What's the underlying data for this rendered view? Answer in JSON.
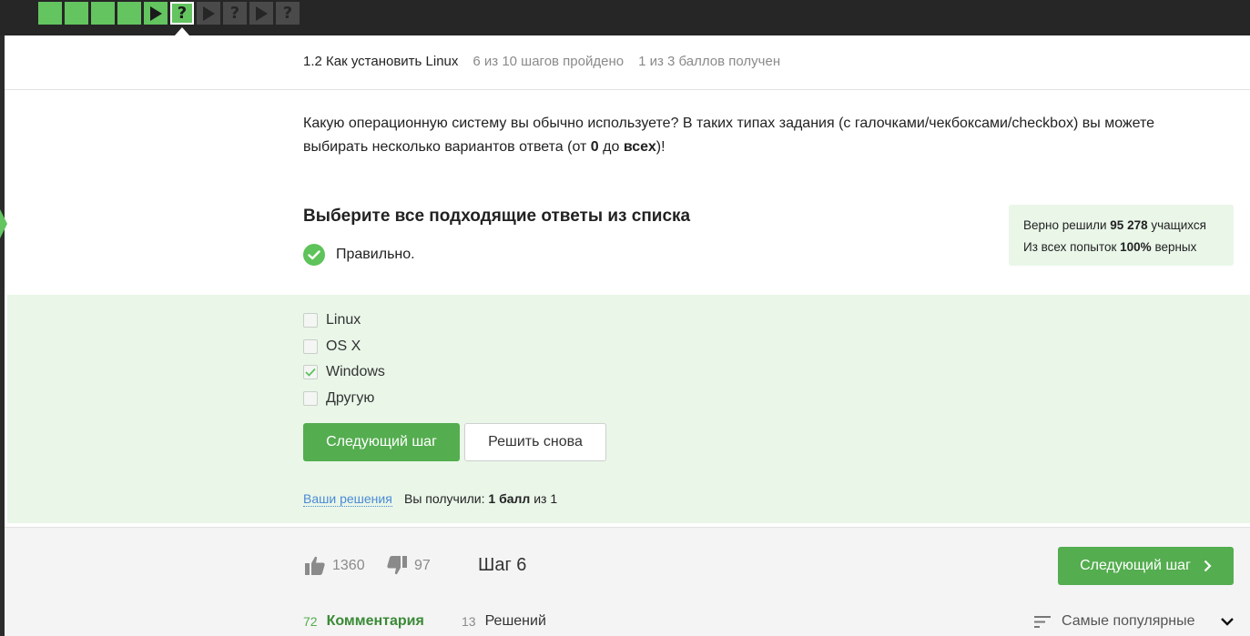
{
  "stepper": {
    "steps": [
      {
        "type": "done"
      },
      {
        "type": "done"
      },
      {
        "type": "done"
      },
      {
        "type": "done"
      },
      {
        "type": "play-done"
      },
      {
        "type": "current",
        "glyph": "?"
      },
      {
        "type": "play"
      },
      {
        "type": "question",
        "glyph": "?"
      },
      {
        "type": "play"
      },
      {
        "type": "question",
        "glyph": "?"
      }
    ]
  },
  "header": {
    "lesson": "1.2 Как установить Linux",
    "progress": "6 из 10 шагов пройдено",
    "points": "1 из 3 баллов  получен"
  },
  "question": {
    "text_before": "Какую операционную систему вы обычно используете? В таких типах задания (с галочками/чекбоксами/checkbox) вы можете выбирать несколько вариантов ответа (от ",
    "bold_from": "0",
    "text_mid": " до ",
    "bold_to": "всех",
    "text_after": ")!"
  },
  "task": {
    "title": "Выберите все подходящие ответы из списка",
    "verdict": "Правильно."
  },
  "stats": {
    "solved_prefix": "Верно решили ",
    "solved_count": "95 278",
    "solved_suffix": " учащихся",
    "attempts_prefix": "Из всех попыток ",
    "attempts_pct": "100%",
    "attempts_suffix": " верных"
  },
  "options": [
    {
      "label": "Linux",
      "checked": false
    },
    {
      "label": "OS X",
      "checked": false
    },
    {
      "label": "Windows",
      "checked": true
    },
    {
      "label": "Другую",
      "checked": false
    }
  ],
  "actions": {
    "next_step": "Следующий шаг",
    "retry": "Решить снова",
    "your_solutions": "Ваши решения",
    "score_prefix": "Вы получили: ",
    "score_value": "1 балл",
    "score_suffix": " из 1"
  },
  "footer": {
    "likes": "1360",
    "dislikes": "97",
    "step_label": "Шаг 6",
    "next_button": "Следующий шаг",
    "comments_count": "72",
    "comments_label": "Комментария",
    "solutions_count": "13",
    "solutions_label": "Решений",
    "sort_label": "Самые популярные"
  },
  "colors": {
    "accent_green": "#54ad4f",
    "light_green_bg": "#e9f6e8",
    "topbar": "#262626"
  }
}
